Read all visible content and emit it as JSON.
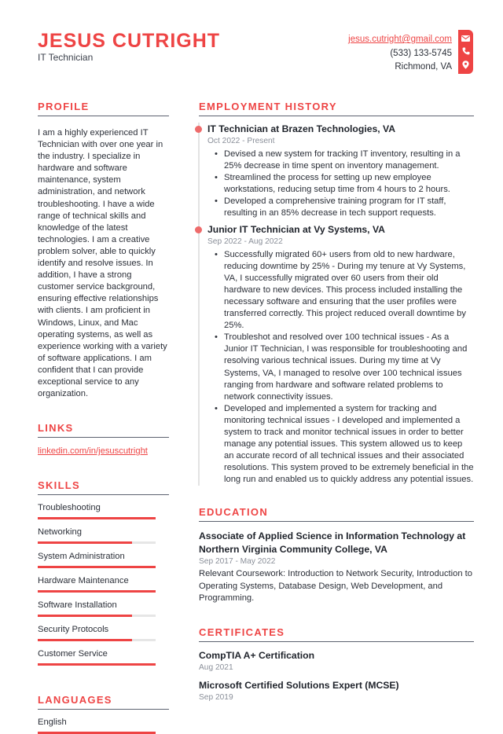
{
  "header": {
    "name": "JESUS CUTRIGHT",
    "title": "IT Technician",
    "email": "jesus.cutright@gmail.com",
    "phone": "(533) 133-5745",
    "location": "Richmond, VA",
    "icons": [
      "envelope-icon",
      "phone-icon",
      "map-pin-icon"
    ],
    "accent_color": "#ee4444"
  },
  "profile": {
    "heading": "PROFILE",
    "text": "I am a highly experienced IT Technician with over one year in the industry. I specialize in hardware and software maintenance, system administration, and network troubleshooting. I have a wide range of technical skills and knowledge of the latest technologies. I am a creative problem solver, able to quickly identify and resolve issues. In addition, I have a strong customer service background, ensuring effective relationships with clients. I am proficient in Windows, Linux, and Mac operating systems, as well as experience working with a variety of software applications. I am confident that I can provide exceptional service to any organization."
  },
  "links": {
    "heading": "LINKS",
    "items": [
      {
        "label": "linkedin.com/in/jesuscutright"
      }
    ]
  },
  "skills": {
    "heading": "SKILLS",
    "items": [
      {
        "label": "Troubleshooting",
        "level": 1.0
      },
      {
        "label": "Networking",
        "level": 0.8
      },
      {
        "label": "System Administration",
        "level": 1.0
      },
      {
        "label": "Hardware Maintenance",
        "level": 1.0
      },
      {
        "label": "Software Installation",
        "level": 0.8
      },
      {
        "label": "Security Protocols",
        "level": 0.8
      },
      {
        "label": "Customer Service",
        "level": 1.0
      }
    ]
  },
  "languages": {
    "heading": "LANGUAGES",
    "items": [
      {
        "label": "English",
        "level": 1.0
      }
    ]
  },
  "employment": {
    "heading": "EMPLOYMENT HISTORY",
    "jobs": [
      {
        "title": "IT Technician at Brazen Technologies, VA",
        "dates": "Oct 2022 - Present",
        "bullets": [
          "Devised a new system for tracking IT inventory, resulting in a 25% decrease in time spent on inventory management.",
          "Streamlined the process for setting up new employee workstations, reducing setup time from 4 hours to 2 hours.",
          "Developed a comprehensive training program for IT staff, resulting in an 85% decrease in tech support requests."
        ]
      },
      {
        "title": "Junior IT Technician at Vy Systems, VA",
        "dates": "Sep 2022 - Aug 2022",
        "bullets": [
          "Successfully migrated 60+ users from old to new hardware, reducing downtime by 25% - During my tenure at Vy Systems, VA, I successfully migrated over 60 users from their old hardware to new devices. This process included installing the necessary software and ensuring that the user profiles were transferred correctly. This project reduced overall downtime by 25%.",
          "Troubleshot and resolved over 100 technical issues - As a Junior IT Technician, I was responsible for troubleshooting and resolving various technical issues. During my time at Vy Systems, VA, I managed to resolve over 100 technical issues ranging from hardware and software related problems to network connectivity issues.",
          "Developed and implemented a system for tracking and monitoring technical issues - I developed and implemented a system to track and monitor technical issues in order to better manage any potential issues. This system allowed us to keep an accurate record of all technical issues and their associated resolutions. This system proved to be extremely beneficial in the long run and enabled us to quickly address any potential issues."
        ]
      }
    ]
  },
  "education": {
    "heading": "EDUCATION",
    "items": [
      {
        "title": "Associate of Applied Science in Information Technology at Northern Virginia Community College, VA",
        "dates": "Sep 2017 - May 2022",
        "description": "Relevant Coursework: Introduction to Network Security, Introduction to Operating Systems, Database Design, Web Development, and Programming."
      }
    ]
  },
  "certificates": {
    "heading": "CERTIFICATES",
    "items": [
      {
        "title": "CompTIA A+ Certification",
        "date": "Aug 2021"
      },
      {
        "title": "Microsoft Certified Solutions Expert (MCSE)",
        "date": "Sep 2019"
      }
    ]
  }
}
